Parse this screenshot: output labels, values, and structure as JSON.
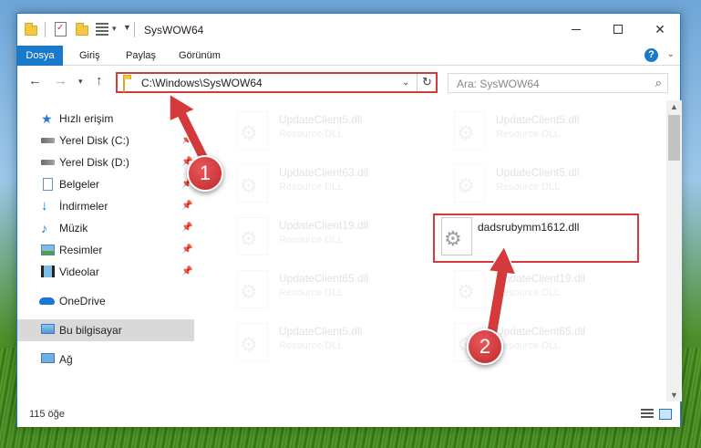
{
  "window": {
    "title": "SysWOW64"
  },
  "ribbon": {
    "tabs": [
      {
        "label": "Dosya"
      },
      {
        "label": "Giriş"
      },
      {
        "label": "Paylaş"
      },
      {
        "label": "Görünüm"
      }
    ],
    "help_label": "?"
  },
  "navigation": {
    "address": "C:\\Windows\\SysWOW64",
    "search_placeholder": "Ara: SysWOW64"
  },
  "sidebar": {
    "items": [
      {
        "label": "Hızlı erişim",
        "icon": "star-icon",
        "pinned": false
      },
      {
        "label": "Yerel Disk (C:)",
        "icon": "drive-icon",
        "pinned": true
      },
      {
        "label": "Yerel Disk (D:)",
        "icon": "drive-icon",
        "pinned": true
      },
      {
        "label": "Belgeler",
        "icon": "documents-icon",
        "pinned": true
      },
      {
        "label": "İndirmeler",
        "icon": "download-icon",
        "pinned": true
      },
      {
        "label": "Müzik",
        "icon": "music-icon",
        "pinned": true
      },
      {
        "label": "Resimler",
        "icon": "pictures-icon",
        "pinned": true
      },
      {
        "label": "Videolar",
        "icon": "videos-icon",
        "pinned": true
      },
      {
        "label": "OneDrive",
        "icon": "onedrive-icon",
        "pinned": false
      },
      {
        "label": "Bu bilgisayar",
        "icon": "this-pc-icon",
        "pinned": false,
        "selected": true
      },
      {
        "label": "Ağ",
        "icon": "network-icon",
        "pinned": false
      }
    ]
  },
  "files": [
    {
      "name": "UpdateClient5.dll",
      "type": "Resource DLL",
      "faded": true
    },
    {
      "name": "UpdateClient5.dll",
      "type": "Resource DLL",
      "faded": true
    },
    {
      "name": "UpdateClient63.dll",
      "type": "Resource DLL",
      "faded": true
    },
    {
      "name": "UpdateClient5.dll",
      "type": "Resource DLL",
      "faded": true
    },
    {
      "name": "UpdateClient19.dll",
      "type": "Resource DLL",
      "faded": true
    },
    {
      "name": "dadsrubymm1612.dll",
      "type": "",
      "faded": false,
      "highlighted": true
    },
    {
      "name": "UpdateClient65.dll",
      "type": "Resource DLL",
      "faded": true
    },
    {
      "name": "UpdateClient19.dll",
      "type": "Resource DLL",
      "faded": true
    },
    {
      "name": "UpdateClient5.dll",
      "type": "Resource DLL",
      "faded": true
    },
    {
      "name": "UpdateClient65.dll",
      "type": "Resource DLL",
      "faded": true
    }
  ],
  "status": {
    "item_count": "115 öğe"
  },
  "annotations": {
    "step1": "1",
    "step2": "2",
    "color": "#d4393b"
  }
}
